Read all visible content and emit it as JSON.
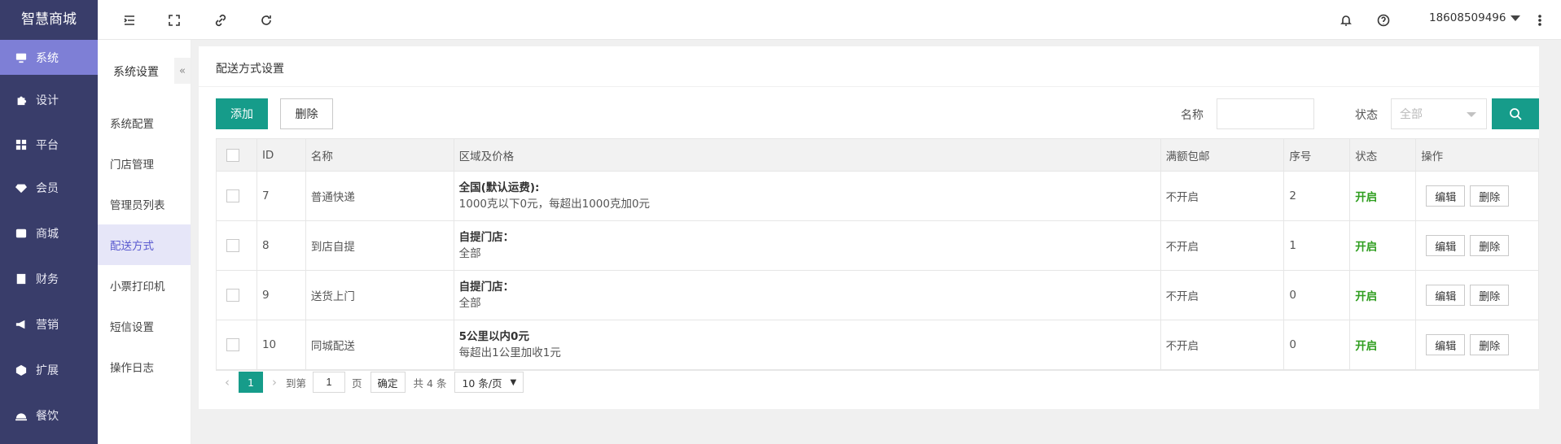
{
  "app": {
    "brand": "智慧商城"
  },
  "nav": {
    "items": [
      {
        "label": "系统",
        "icon": "monitor-icon",
        "active": true
      },
      {
        "label": "设计",
        "icon": "puzzle-icon"
      },
      {
        "label": "平台",
        "icon": "grid-icon"
      },
      {
        "label": "会员",
        "icon": "gem-icon"
      },
      {
        "label": "商城",
        "icon": "shop-icon"
      },
      {
        "label": "财务",
        "icon": "ledger-icon"
      },
      {
        "label": "营销",
        "icon": "megaphone-icon"
      },
      {
        "label": "扩展",
        "icon": "cube-icon"
      },
      {
        "label": "餐饮",
        "icon": "cloche-icon"
      }
    ]
  },
  "subnav": {
    "title": "系统设置",
    "items": [
      {
        "label": "系统配置"
      },
      {
        "label": "门店管理"
      },
      {
        "label": "管理员列表"
      },
      {
        "label": "配送方式",
        "active": true
      },
      {
        "label": "小票打印机"
      },
      {
        "label": "短信设置"
      },
      {
        "label": "操作日志"
      }
    ]
  },
  "topbar": {
    "user": "18608509496"
  },
  "page": {
    "title": "配送方式设置",
    "add_label": "添加",
    "delete_label": "删除",
    "name_label": "名称",
    "name_value": "",
    "status_label": "状态",
    "status_value": "全部"
  },
  "table": {
    "headers": [
      "ID",
      "名称",
      "区域及价格",
      "满额包邮",
      "序号",
      "状态",
      "操作"
    ],
    "rows": [
      {
        "id": "7",
        "name": "普通快递",
        "region_title": "全国(默认运费):",
        "region_detail": "1000克以下0元，每超出1000克加0元",
        "free": "不开启",
        "order": "2",
        "status": "开启"
      },
      {
        "id": "8",
        "name": "到店自提",
        "region_title": "自提门店：",
        "region_detail": "全部",
        "free": "不开启",
        "order": "1",
        "status": "开启"
      },
      {
        "id": "9",
        "name": "送货上门",
        "region_title": "自提门店：",
        "region_detail": "全部",
        "free": "不开启",
        "order": "0",
        "status": "开启"
      },
      {
        "id": "10",
        "name": "同城配送",
        "region_title": "5公里以内0元",
        "region_detail": "每超出1公里加收1元",
        "free": "不开启",
        "order": "0",
        "status": "开启"
      }
    ],
    "edit_label": "编辑",
    "delete_label": "删除"
  },
  "pager": {
    "current": "1",
    "goto_label": "到第",
    "goto_value": "1",
    "page_suffix": "页",
    "ok_label": "确定",
    "total": "共 4 条",
    "size": "10 条/页"
  },
  "colors": {
    "sidebar": "#393d6a",
    "active_nav": "#7e7fd6",
    "primary": "#169c8a",
    "status_on": "#2f9e1f"
  }
}
